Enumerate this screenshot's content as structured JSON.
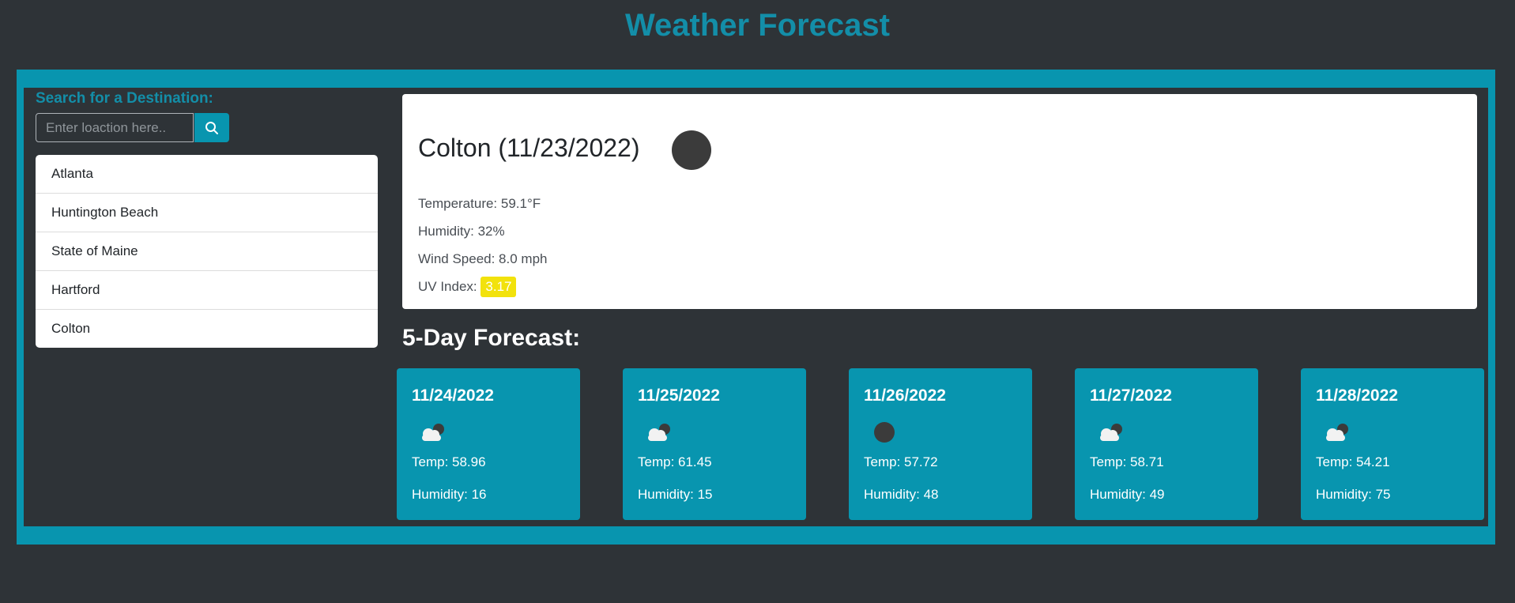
{
  "header": {
    "title": "Weather Forecast"
  },
  "search": {
    "label": "Search for a Destination:",
    "placeholder": "Enter loaction here..",
    "value": "",
    "button_icon": "search-icon"
  },
  "history": {
    "items": [
      {
        "label": "Atlanta"
      },
      {
        "label": "Huntington Beach"
      },
      {
        "label": "State of Maine"
      },
      {
        "label": "Hartford"
      },
      {
        "label": "Colton"
      }
    ]
  },
  "current": {
    "title": "Colton (11/23/2022)",
    "icon": "clear-night-icon",
    "temperature": "Temperature: 59.1°F",
    "humidity": "Humidity: 32%",
    "wind": "Wind Speed: 8.0 mph",
    "uv_label": "UV Index:",
    "uv_value": "3.17",
    "uv_color": "#f2e20c"
  },
  "forecast": {
    "heading": "5-Day Forecast:",
    "days": [
      {
        "date": "11/24/2022",
        "icon": "partly-cloudy-night-icon",
        "temp": "Temp: 58.96",
        "humidity": "Humidity: 16"
      },
      {
        "date": "11/25/2022",
        "icon": "partly-cloudy-night-icon",
        "temp": "Temp: 61.45",
        "humidity": "Humidity: 15"
      },
      {
        "date": "11/26/2022",
        "icon": "clear-night-icon",
        "temp": "Temp: 57.72",
        "humidity": "Humidity: 48"
      },
      {
        "date": "11/27/2022",
        "icon": "partly-cloudy-night-icon",
        "temp": "Temp: 58.71",
        "humidity": "Humidity: 49"
      },
      {
        "date": "11/28/2022",
        "icon": "partly-cloudy-night-icon",
        "temp": "Temp: 54.21",
        "humidity": "Humidity: 75"
      }
    ]
  },
  "colors": {
    "accent": "#0895af",
    "title": "#138ea8",
    "background": "#2e3337",
    "uv_moderate": "#f2e20c"
  }
}
